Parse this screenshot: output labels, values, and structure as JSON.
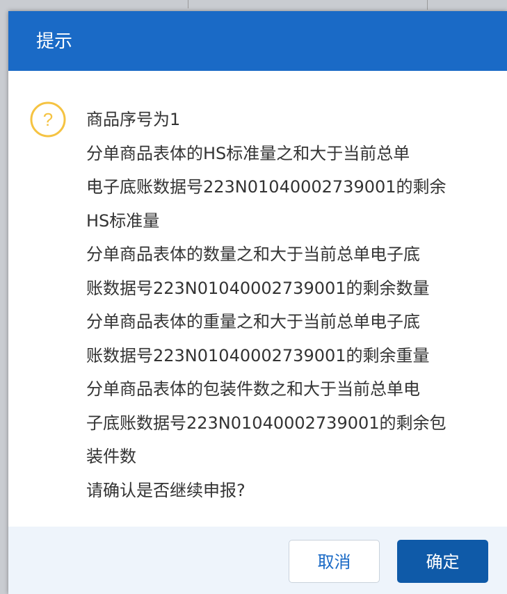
{
  "dialog": {
    "title": "提示",
    "icon": "question-icon",
    "icon_color": "#f5c342",
    "header_color": "#1a6ac6",
    "message_lines": [
      "商品序号为1",
      "分单商品表体的HS标准量之和大于当前总单",
      "电子底账数据号223N0104000273900​1的剩余",
      "HS标准量",
      "分单商品表体的数量之和大于当前总单电子底",
      "账数据号223N0104000273900​1的剩余数量",
      "分单商品表体的重量之和大于当前总单电子底",
      "账数据号223N0104000273900​1的剩余重量",
      "分单商品表体的包装件数之和大于当前总单电",
      "子底账数据号223N0104000273900​1的剩余包",
      "装件数",
      "请确认是否继续申报?"
    ],
    "buttons": {
      "cancel_label": "取消",
      "ok_label": "确定"
    },
    "ok_color": "#0f5aa8"
  }
}
